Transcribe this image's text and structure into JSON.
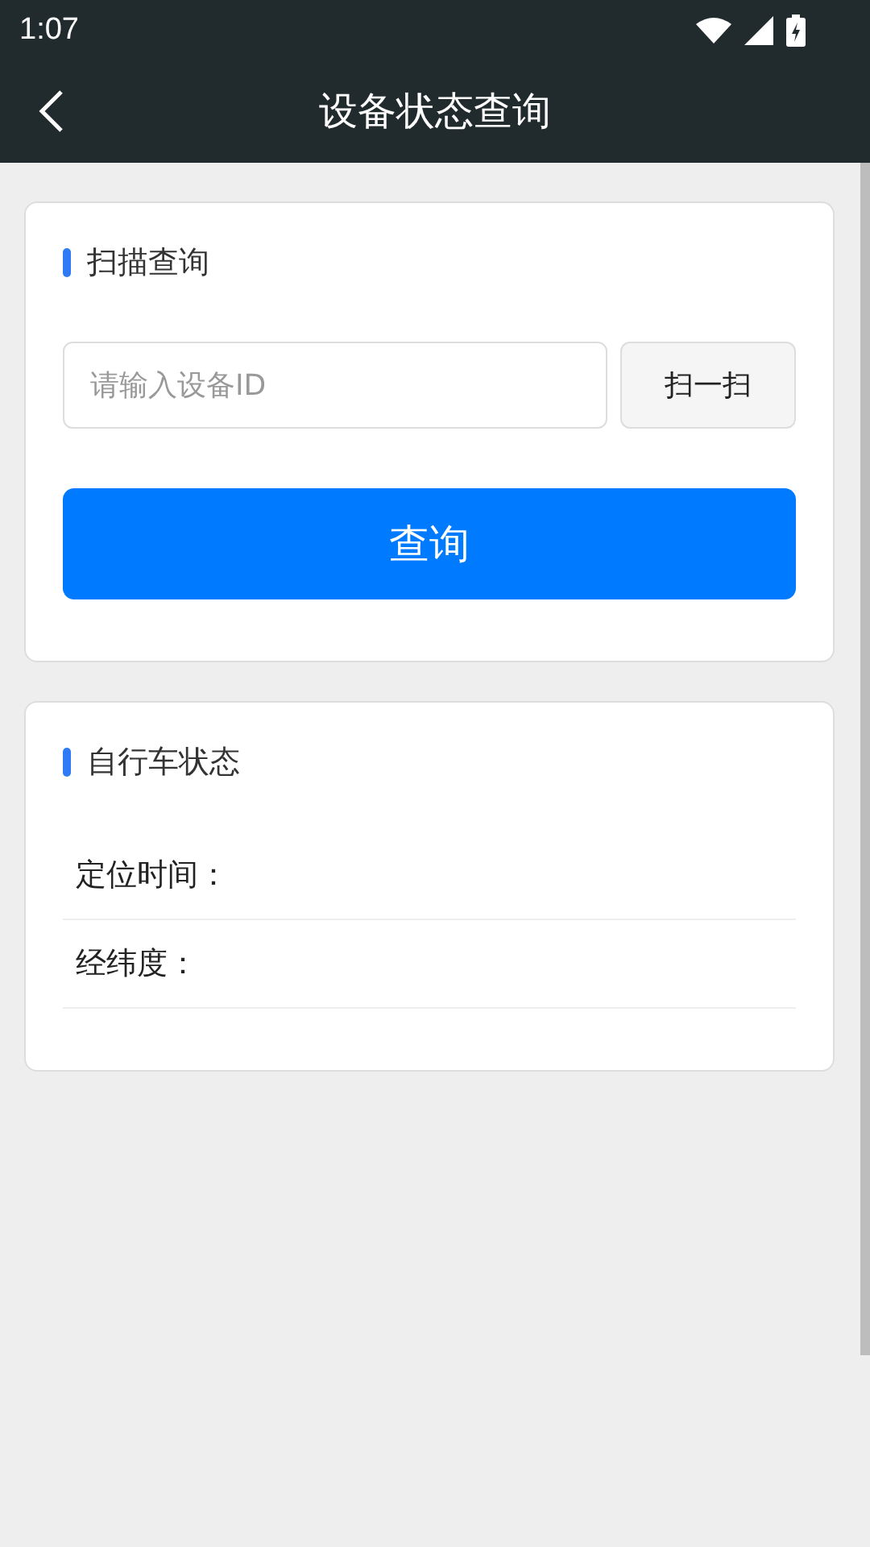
{
  "status_bar": {
    "time": "1:07"
  },
  "header": {
    "title": "设备状态查询"
  },
  "scan_card": {
    "title": "扫描查询",
    "input": {
      "placeholder": "请输入设备ID"
    },
    "scan_button": "扫一扫",
    "query_button": "查询"
  },
  "status_card": {
    "title": "自行车状态",
    "rows": [
      {
        "label": "定位时间："
      },
      {
        "label": "经纬度："
      }
    ]
  }
}
